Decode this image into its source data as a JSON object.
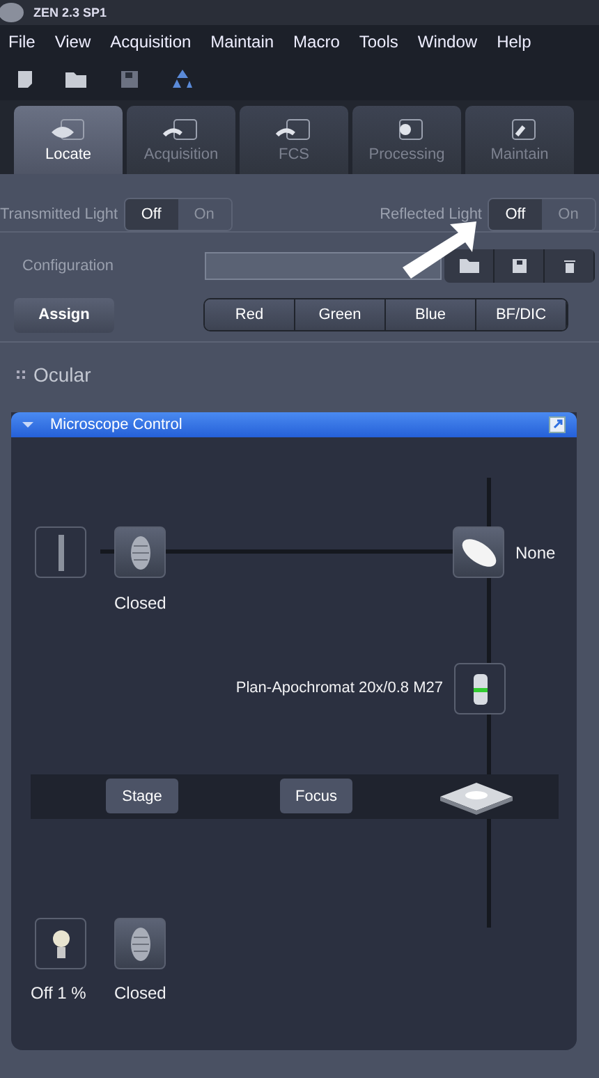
{
  "window": {
    "title": "ZEN 2.3 SP1"
  },
  "menu": [
    "File",
    "View",
    "Acquisition",
    "Maintain",
    "Macro",
    "Tools",
    "Window",
    "Help"
  ],
  "tabs": [
    {
      "label": "Locate",
      "selected": true
    },
    {
      "label": "Acquisition",
      "selected": false
    },
    {
      "label": "FCS",
      "selected": false
    },
    {
      "label": "Processing",
      "selected": false
    },
    {
      "label": "Maintain",
      "selected": false
    }
  ],
  "light_switches": [
    {
      "label": "Transmitted Light",
      "options": [
        {
          "label": "Off",
          "selected": true
        },
        {
          "label": "On",
          "selected": false
        }
      ]
    },
    {
      "label": "Reflected Light",
      "options": [
        {
          "label": "Off",
          "selected": true
        },
        {
          "label": "On",
          "selected": false
        }
      ]
    }
  ],
  "configuration": {
    "label": "Configuration"
  },
  "assign_button": "Assign",
  "channel_buttons": [
    "Red",
    "Green",
    "Blue",
    "BF/DIC"
  ],
  "ocular_section": {
    "title": "Ocular"
  },
  "microscope_control": {
    "title": "Microscope Control",
    "expanded": true,
    "top_shutter": "Closed",
    "reflector": "None",
    "objective": "Plan-Apochromat 20x/0.8 M27",
    "stage_button": "Stage",
    "focus_button": "Focus",
    "lamp": "Off 1 %",
    "bottom_shutter": "Closed"
  }
}
